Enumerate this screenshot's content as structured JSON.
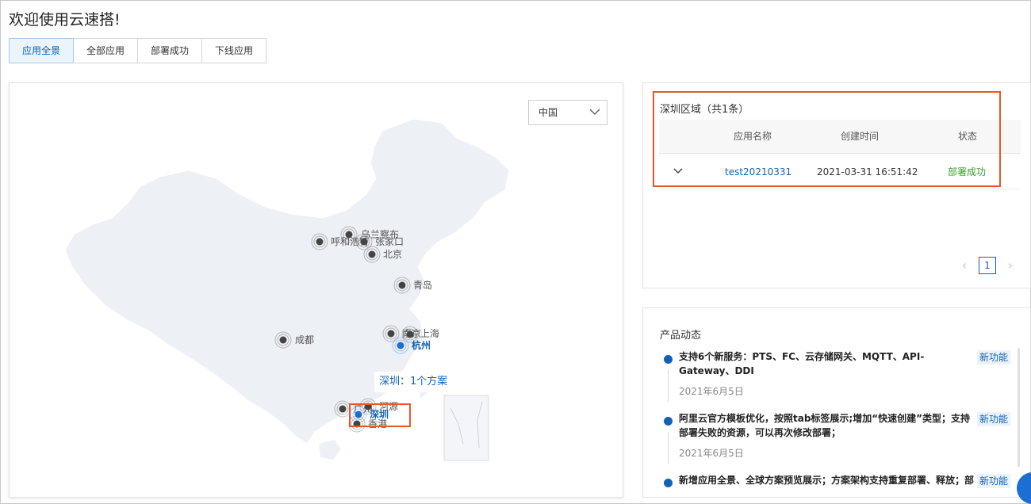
{
  "page": {
    "title": "欢迎使用云速搭!"
  },
  "tabs": [
    {
      "label": "应用全景",
      "active": true
    },
    {
      "label": "全部应用",
      "active": false
    },
    {
      "label": "部署成功",
      "active": false
    },
    {
      "label": "下线应用",
      "active": false
    }
  ],
  "map": {
    "region_select": {
      "value": "中国",
      "icon": "chevron-down-icon"
    },
    "cities": [
      {
        "name": "乌兰察布",
        "active": false
      },
      {
        "name": "呼和浩特",
        "active": false
      },
      {
        "name": "张家口",
        "active": false
      },
      {
        "name": "北京",
        "active": false
      },
      {
        "name": "青岛",
        "active": false
      },
      {
        "name": "成都",
        "active": false
      },
      {
        "name": "南京",
        "active": false
      },
      {
        "name": "上海",
        "active": false
      },
      {
        "name": "杭州",
        "active": true
      },
      {
        "name": "广州",
        "active": false
      },
      {
        "name": "河源",
        "active": false
      },
      {
        "name": "深圳",
        "active": true
      },
      {
        "name": "香港",
        "active": false
      }
    ],
    "tooltip": "深圳：1个方案",
    "colors": {
      "land": "#edf0f5",
      "marker": "#444444",
      "active_marker": "#1b6ed3",
      "highlight": "#e5582f"
    }
  },
  "region_panel": {
    "title": "深圳区域（共1条）",
    "columns": [
      "应用名称",
      "创建时间",
      "状态"
    ],
    "rows": [
      {
        "name": "test20210331",
        "created": "2021-03-31 16:51:42",
        "status": "部署成功"
      }
    ],
    "pagination": {
      "current": "1"
    }
  },
  "news": {
    "title": "产品动态",
    "items": [
      {
        "text": "支持6个新服务：PTS、FC、云存储网关、MQTT、API-Gateway、DDI",
        "date": "2021年6月5日",
        "badge": "新功能"
      },
      {
        "text": "阿里云官方模板优化，按照tab标签展示;增加“快速创建”类型；支持部署失败的资源，可以再次修改部署；",
        "date": "2021年6月5日",
        "badge": "新功能"
      },
      {
        "text": "新增应用全景、全球方案预览展示；方案架构支持重复部署、释放；部",
        "date": "",
        "badge": "新功能"
      }
    ]
  }
}
